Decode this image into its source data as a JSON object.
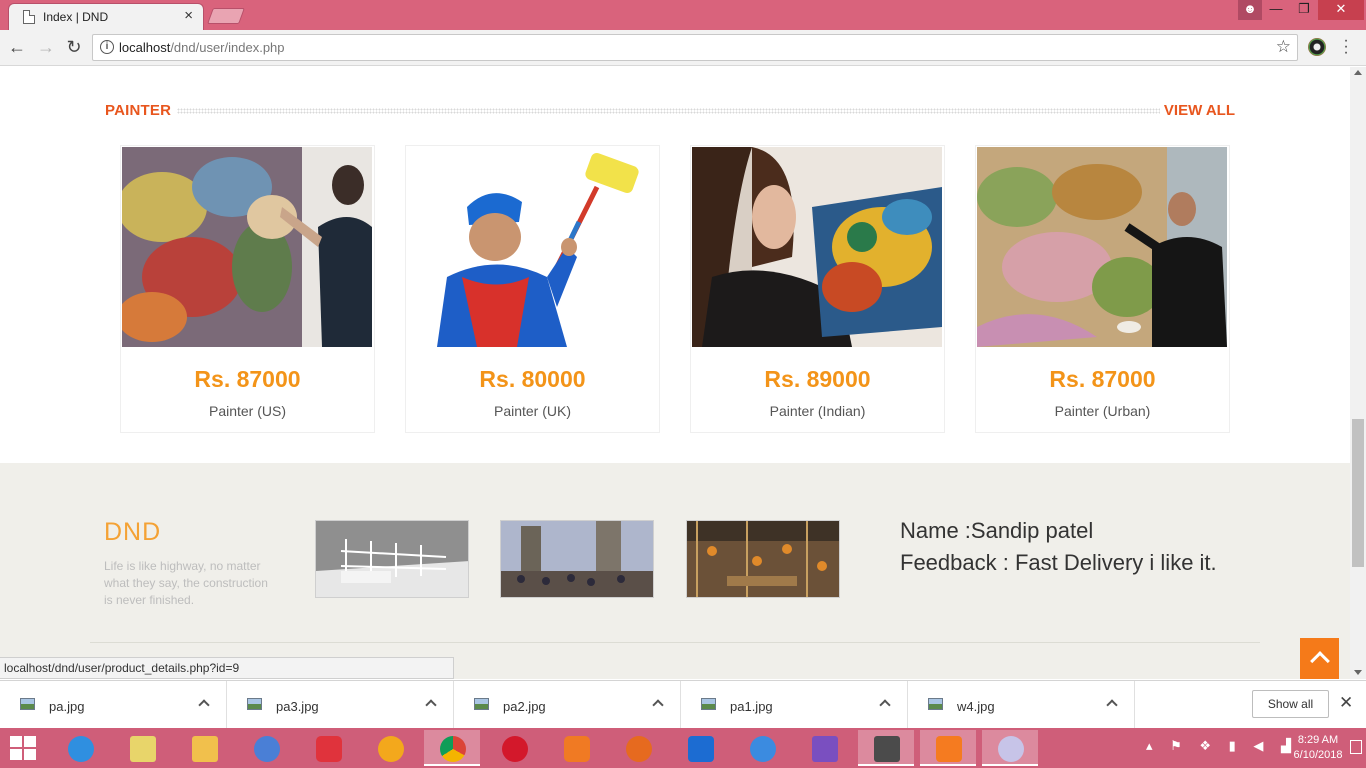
{
  "browser": {
    "tab_title": "Index | DND",
    "tab_close": "×",
    "url_host": "localhost",
    "url_path": "/dnd/user/index.php",
    "status_url": "localhost/dnd/user/product_details.php?id=9"
  },
  "section": {
    "title": "PAINTER",
    "view_all": "VIEW ALL"
  },
  "products": [
    {
      "price": "Rs. 87000",
      "label": "Painter (US)"
    },
    {
      "price": "Rs. 80000",
      "label": "Painter (UK)"
    },
    {
      "price": "Rs. 89000",
      "label": "Painter (Indian)"
    },
    {
      "price": "Rs. 87000",
      "label": "Painter (Urban)"
    }
  ],
  "footer": {
    "brand": "DND",
    "tagline": "Life is like highway, no matter what they say, the construction is never finished.",
    "feedback_name": "Name :Sandip patel",
    "feedback_text": "Feedback : Fast Delivery i like it."
  },
  "downloads": {
    "files": [
      "pa.jpg",
      "pa3.jpg",
      "pa2.jpg",
      "pa1.jpg",
      "w4.jpg"
    ],
    "show_all": "Show all",
    "close": "✕"
  },
  "taskbar": {
    "time": "8:29 AM",
    "date": "6/10/2018"
  },
  "colors": {
    "accent_orange": "#e8561e",
    "price_orange": "#f39419",
    "chrome_pink": "#d9637c"
  }
}
